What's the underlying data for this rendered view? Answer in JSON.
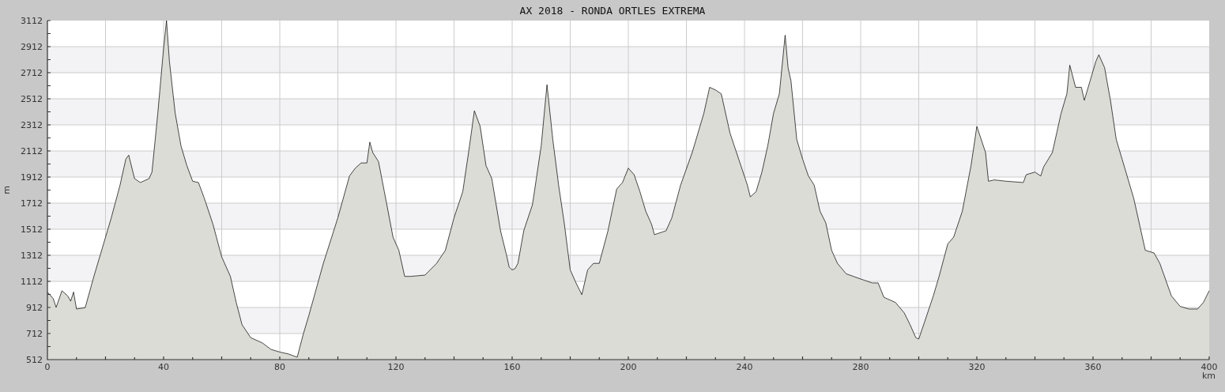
{
  "chart_data": {
    "type": "area",
    "title": "AX 2018 - RONDA ORTLES EXTREMA",
    "xlabel": "km",
    "ylabel": "m",
    "xlim": [
      0,
      400
    ],
    "ylim": [
      512,
      3112
    ],
    "xticks": [
      0,
      40,
      80,
      120,
      160,
      200,
      240,
      280,
      320,
      360,
      400
    ],
    "yticks": [
      512,
      712,
      912,
      1112,
      1312,
      1512,
      1712,
      1912,
      2112,
      2312,
      2512,
      2712,
      2912,
      3112
    ],
    "x": [
      0,
      2,
      3,
      5,
      7,
      8,
      9,
      10,
      13,
      16,
      20,
      22,
      25,
      27,
      28,
      30,
      32,
      35,
      36,
      38,
      40,
      41,
      42,
      44,
      46,
      48,
      50,
      52,
      54,
      57,
      60,
      63,
      65,
      67,
      70,
      74,
      77,
      80,
      83,
      86,
      88,
      90,
      95,
      100,
      104,
      106,
      108,
      110,
      111,
      112,
      114,
      116,
      119,
      121,
      123,
      125,
      130,
      134,
      137,
      140,
      143,
      145,
      147,
      149,
      151,
      153,
      156,
      158,
      159,
      160,
      161,
      162,
      164,
      167,
      170,
      172,
      174,
      176,
      178,
      180,
      182,
      184,
      186,
      188,
      190,
      193,
      196,
      198,
      200,
      202,
      204,
      206,
      208,
      209,
      213,
      215,
      218,
      222,
      226,
      228,
      230,
      232,
      235,
      238,
      241,
      242,
      244,
      246,
      248,
      250,
      252,
      254,
      255,
      256,
      258,
      260,
      262,
      264,
      266,
      268,
      270,
      272,
      275,
      280,
      284,
      286,
      288,
      292,
      295,
      297,
      299,
      300,
      302,
      305,
      307,
      310,
      312,
      315,
      318,
      320,
      323,
      324,
      326,
      330,
      336,
      337,
      340,
      342,
      343,
      346,
      349,
      351,
      352,
      354,
      356,
      357,
      359,
      361,
      362,
      364,
      366,
      368,
      370,
      374,
      378,
      381,
      383,
      387,
      390,
      393,
      396,
      398,
      400
    ],
    "grid": true,
    "series": [
      {
        "color": "#dcdcd6",
        "values": [
          1030,
          980,
          912,
          1040,
          1000,
          960,
          1030,
          900,
          910,
          1150,
          1450,
          1600,
          1850,
          2050,
          2080,
          1900,
          1870,
          1900,
          1950,
          2400,
          2900,
          3112,
          2800,
          2400,
          2150,
          2000,
          1880,
          1870,
          1750,
          1550,
          1300,
          1150,
          950,
          780,
          680,
          640,
          590,
          570,
          555,
          530,
          700,
          850,
          1250,
          1600,
          1920,
          1980,
          2020,
          2020,
          2180,
          2100,
          2030,
          1800,
          1450,
          1350,
          1150,
          1150,
          1160,
          1250,
          1350,
          1600,
          1800,
          2100,
          2420,
          2300,
          2000,
          1900,
          1500,
          1320,
          1220,
          1200,
          1210,
          1250,
          1500,
          1700,
          2150,
          2620,
          2200,
          1850,
          1550,
          1200,
          1100,
          1010,
          1200,
          1250,
          1250,
          1500,
          1820,
          1870,
          1980,
          1930,
          1800,
          1650,
          1550,
          1470,
          1500,
          1600,
          1850,
          2100,
          2400,
          2600,
          2580,
          2550,
          2250,
          2050,
          1850,
          1760,
          1800,
          1950,
          2150,
          2400,
          2550,
          3000,
          2750,
          2650,
          2200,
          2050,
          1920,
          1850,
          1650,
          1560,
          1350,
          1250,
          1170,
          1130,
          1100,
          1100,
          990,
          950,
          870,
          780,
          680,
          670,
          800,
          1000,
          1150,
          1400,
          1450,
          1650,
          2000,
          2300,
          2100,
          1880,
          1890,
          1880,
          1870,
          1930,
          1950,
          1920,
          1990,
          2100,
          2400,
          2550,
          2770,
          2600,
          2600,
          2500,
          2650,
          2800,
          2850,
          2750,
          2500,
          2200,
          2050,
          1750,
          1350,
          1330,
          1250,
          1000,
          920,
          900,
          900,
          950,
          1040
        ]
      }
    ]
  }
}
